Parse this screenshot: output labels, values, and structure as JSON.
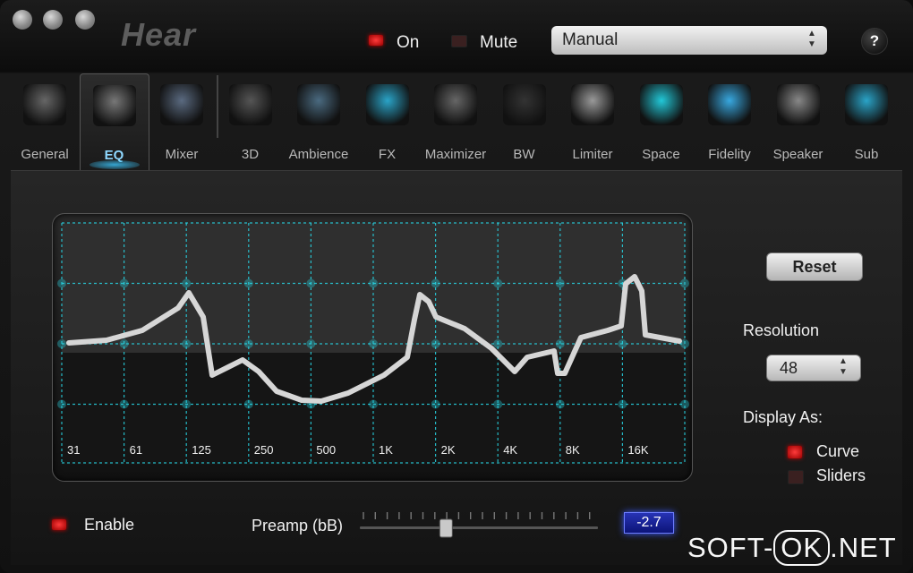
{
  "window": {
    "app_name": "Hear"
  },
  "header": {
    "on_label": "On",
    "mute_label": "Mute",
    "preset_value": "Manual",
    "help_label": "?"
  },
  "tabs": [
    {
      "label": "General",
      "icon": "disc-icon"
    },
    {
      "label": "EQ",
      "icon": "eq-sliders-icon",
      "selected": true
    },
    {
      "label": "Mixer",
      "icon": "mixer-icon"
    },
    {
      "label": "3D",
      "icon": "speakers-3d-icon"
    },
    {
      "label": "Ambience",
      "icon": "ambience-speaker-icon"
    },
    {
      "label": "FX",
      "icon": "fx-icon"
    },
    {
      "label": "Maximizer",
      "icon": "headphones-icon"
    },
    {
      "label": "BW",
      "icon": "bust-icon"
    },
    {
      "label": "Limiter",
      "icon": "vu-meter-icon"
    },
    {
      "label": "Space",
      "icon": "space-room-icon"
    },
    {
      "label": "Fidelity",
      "icon": "fidelity-icon"
    },
    {
      "label": "Speaker",
      "icon": "speaker-icon"
    },
    {
      "label": "Sub",
      "icon": "subwoofer-icon"
    }
  ],
  "eq": {
    "bands": [
      "31",
      "61",
      "125",
      "250",
      "500",
      "1K",
      "2K",
      "4K",
      "8K",
      "16K"
    ],
    "curve_color": "#d6d6d6",
    "grid_color": "#27d6e6"
  },
  "right": {
    "reset_label": "Reset",
    "resolution_label": "Resolution",
    "resolution_value": "48",
    "display_as_label": "Display As:",
    "curve_label": "Curve",
    "sliders_label": "Sliders",
    "display_as_selected": "Curve"
  },
  "bottom": {
    "enable_label": "Enable",
    "preamp_label": "Preamp (bB)",
    "preamp_value": "-2.7",
    "preamp_slider_fraction": 0.36
  },
  "watermark": {
    "left": "SOFT-",
    "ok": "OK",
    "right": ".NET"
  }
}
